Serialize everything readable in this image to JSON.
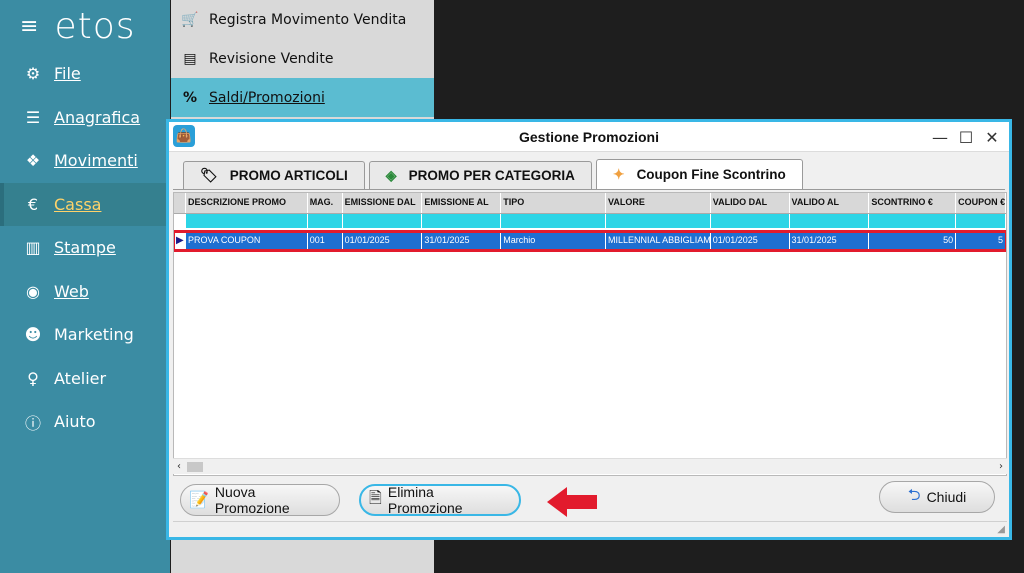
{
  "sidebar": {
    "logo": "etos",
    "menu_icon": "hamburger-icon",
    "items": [
      {
        "label": "File",
        "icon": "gear-icon"
      },
      {
        "label": "Anagrafica",
        "icon": "database-icon"
      },
      {
        "label": "Movimenti",
        "icon": "cubes-icon"
      },
      {
        "label": "Cassa",
        "icon": "euro-icon",
        "active": true
      },
      {
        "label": "Stampe",
        "icon": "bar-chart-icon"
      },
      {
        "label": "Web",
        "icon": "globe-icon"
      },
      {
        "label": "Marketing",
        "icon": "users-icon"
      },
      {
        "label": "Atelier",
        "icon": "person-icon"
      },
      {
        "label": "Aiuto",
        "icon": "info-icon"
      }
    ]
  },
  "submenu": {
    "items": [
      {
        "label": "Registra Movimento Vendita",
        "icon": "cart-icon"
      },
      {
        "label": "Revisione Vendite",
        "icon": "copy-icon"
      },
      {
        "label": "Saldi/Promozioni",
        "icon": "percent-icon",
        "active": true
      }
    ]
  },
  "window": {
    "title": "Gestione Promozioni",
    "controls": {
      "minimize": "—",
      "maximize": "☐",
      "close": "✕"
    },
    "tabs": [
      {
        "label": "PROMO ARTICOLI",
        "icon": "tag-icon"
      },
      {
        "label": "PROMO PER CATEGORIA",
        "icon": "tag-search-icon"
      },
      {
        "label": "Coupon Fine Scontrino",
        "icon": "coupon-icon",
        "active": true
      }
    ],
    "grid": {
      "columns": [
        "DESCRIZIONE PROMO",
        "MAG.",
        "EMISSIONE DAL",
        "EMISSIONE AL",
        "TIPO",
        "VALORE",
        "VALIDO DAL",
        "VALIDO AL",
        "SCONTRINO €",
        "COUPON €"
      ],
      "rows": [
        [
          "PROVA COUPON",
          "001",
          "01/01/2025",
          "31/01/2025",
          "Marchio",
          "MILLENNIAL ABBIGLIAMENTO",
          "01/01/2025",
          "31/01/2025",
          "50",
          "5"
        ]
      ]
    },
    "buttons": {
      "new": "Nuova Promozione",
      "delete": "Elimina Promozione",
      "close": "Chiudi"
    }
  },
  "colors": {
    "sidebar": "#3b8ca3",
    "accent": "#39b7e6",
    "selection": "#1e6fd1",
    "highlight": "#e21b2d",
    "filter": "#2dd5e6"
  }
}
